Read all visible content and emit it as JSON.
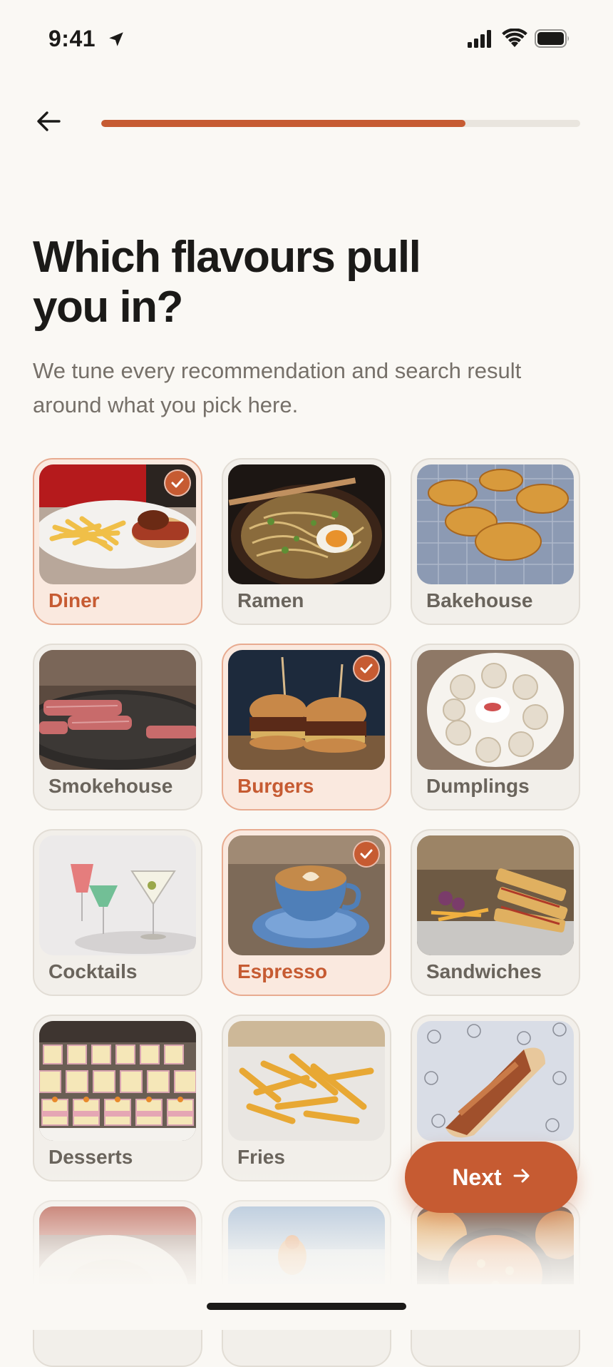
{
  "status_bar": {
    "time": "9:41"
  },
  "onboarding": {
    "progress_fraction": 0.76,
    "title": "Which flavours pull you in?",
    "subtitle": "We tune every recommendation and search result around what you pick here."
  },
  "flavours": [
    {
      "label": "Diner",
      "selected": true
    },
    {
      "label": "Ramen",
      "selected": false
    },
    {
      "label": "Bakehouse",
      "selected": false
    },
    {
      "label": "Smokehouse",
      "selected": false
    },
    {
      "label": "Burgers",
      "selected": true
    },
    {
      "label": "Dumplings",
      "selected": false
    },
    {
      "label": "Cocktails",
      "selected": false
    },
    {
      "label": "Espresso",
      "selected": true
    },
    {
      "label": "Sandwiches",
      "selected": false
    },
    {
      "label": "Desserts",
      "selected": false
    },
    {
      "label": "Fries",
      "selected": false
    },
    {
      "label": "",
      "selected": false
    },
    {
      "label": "",
      "selected": false
    },
    {
      "label": "",
      "selected": false
    },
    {
      "label": "",
      "selected": false
    }
  ],
  "next_button": {
    "label": "Next"
  },
  "colors": {
    "accent": "#c65b32",
    "background": "#faf8f4",
    "text": "#1b1a18",
    "muted": "#767069"
  }
}
